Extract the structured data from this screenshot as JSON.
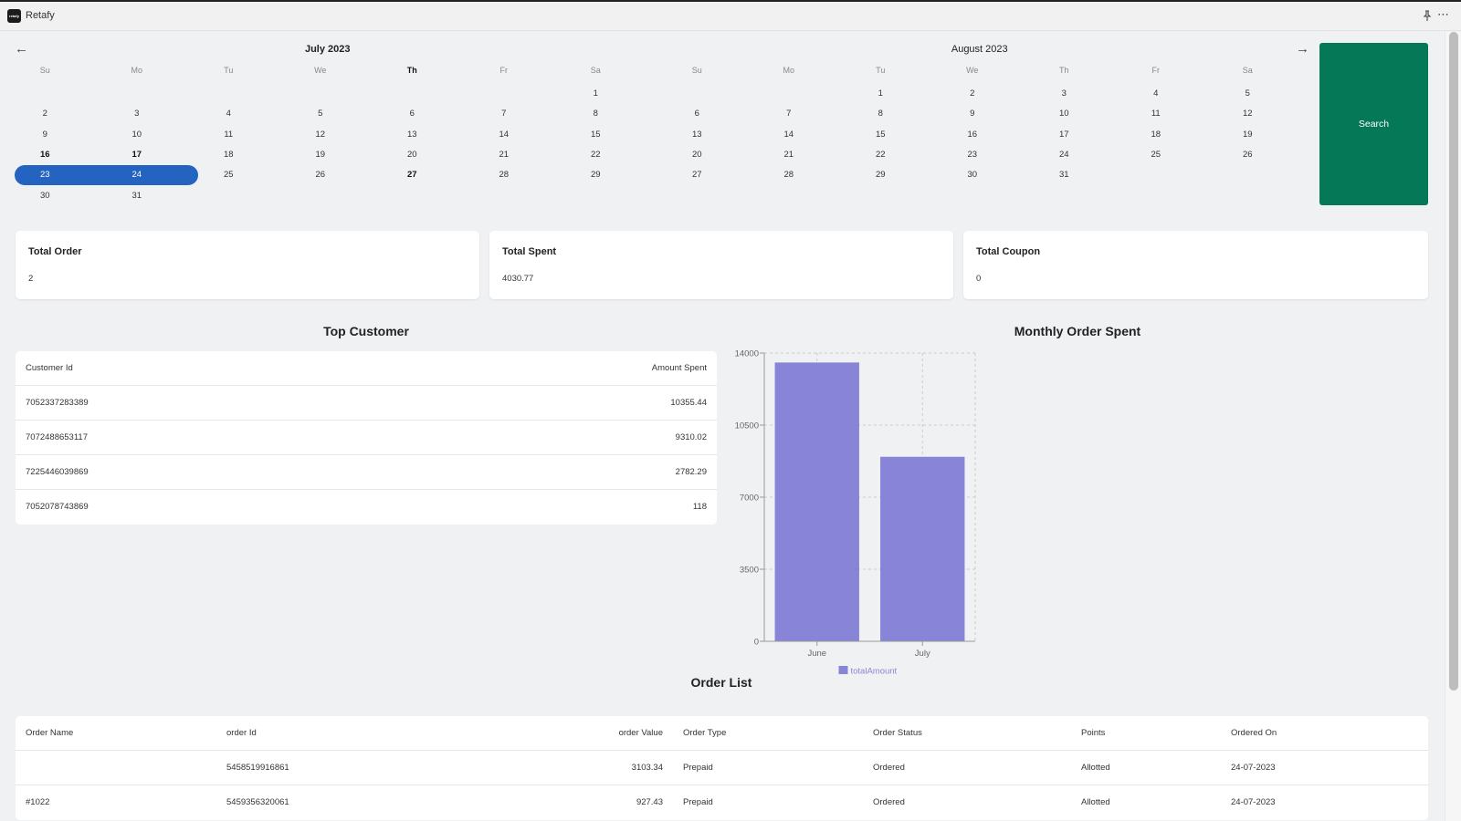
{
  "window": {
    "app_title": "Retafy",
    "app_icon_text": "retafy",
    "pin_icon": "pin-icon",
    "more_icon": "more-icon"
  },
  "calendar": {
    "prev_icon": "arrow-left-icon",
    "next_icon": "arrow-right-icon",
    "weekdays": [
      "Su",
      "Mo",
      "Tu",
      "We",
      "Th",
      "Fr",
      "Sa"
    ],
    "months": [
      {
        "title": "July 2023",
        "start_weekday": 6,
        "days_in_month": 31,
        "bold_days": [
          16,
          17,
          27
        ],
        "highlight_weekday": "Th"
      },
      {
        "title": "August 2023",
        "start_weekday": 2,
        "days_in_month": 31,
        "bold_days": [],
        "highlight_weekday": ""
      }
    ],
    "selected_range": {
      "month": "July 2023",
      "start": 23,
      "end": 24
    },
    "search_label": "Search"
  },
  "stats": [
    {
      "label": "Total Order",
      "value": "2"
    },
    {
      "label": "Total Spent",
      "value": "4030.77"
    },
    {
      "label": "Total Coupon",
      "value": "0"
    }
  ],
  "top_customer": {
    "title": "Top Customer",
    "columns": [
      "Customer Id",
      "Amount Spent"
    ],
    "rows": [
      [
        "7052337283389",
        "10355.44"
      ],
      [
        "7072488653117",
        "9310.02"
      ],
      [
        "7225446039869",
        "2782.29"
      ],
      [
        "7052078743869",
        "118"
      ]
    ]
  },
  "monthly_chart": {
    "title": "Monthly Order Spent"
  },
  "chart_data": {
    "type": "bar",
    "title": "Monthly Order Spent",
    "categories": [
      "June",
      "July"
    ],
    "series": [
      {
        "name": "totalAmount",
        "values": [
          13540,
          8960
        ],
        "color": "#8884d8"
      }
    ],
    "xlabel": "",
    "ylabel": "",
    "ylim": [
      0,
      14000
    ],
    "yticks": [
      0,
      3500,
      7000,
      10500,
      14000
    ],
    "grid": true,
    "legend": "bottom"
  },
  "order_list": {
    "title": "Order List",
    "columns": [
      "Order Name",
      "order Id",
      "order Value",
      "Order Type",
      "Order Status",
      "Points",
      "Ordered On"
    ],
    "rows": [
      [
        "",
        "5458519916861",
        "3103.34",
        "Prepaid",
        "Ordered",
        "Allotted",
        "24-07-2023"
      ],
      [
        "#1022",
        "5459356320061",
        "927.43",
        "Prepaid",
        "Ordered",
        "Allotted",
        "24-07-2023"
      ]
    ]
  },
  "colors": {
    "accent_green": "#047857",
    "selection_blue": "#2463c0",
    "bar_purple": "#8884d8"
  }
}
